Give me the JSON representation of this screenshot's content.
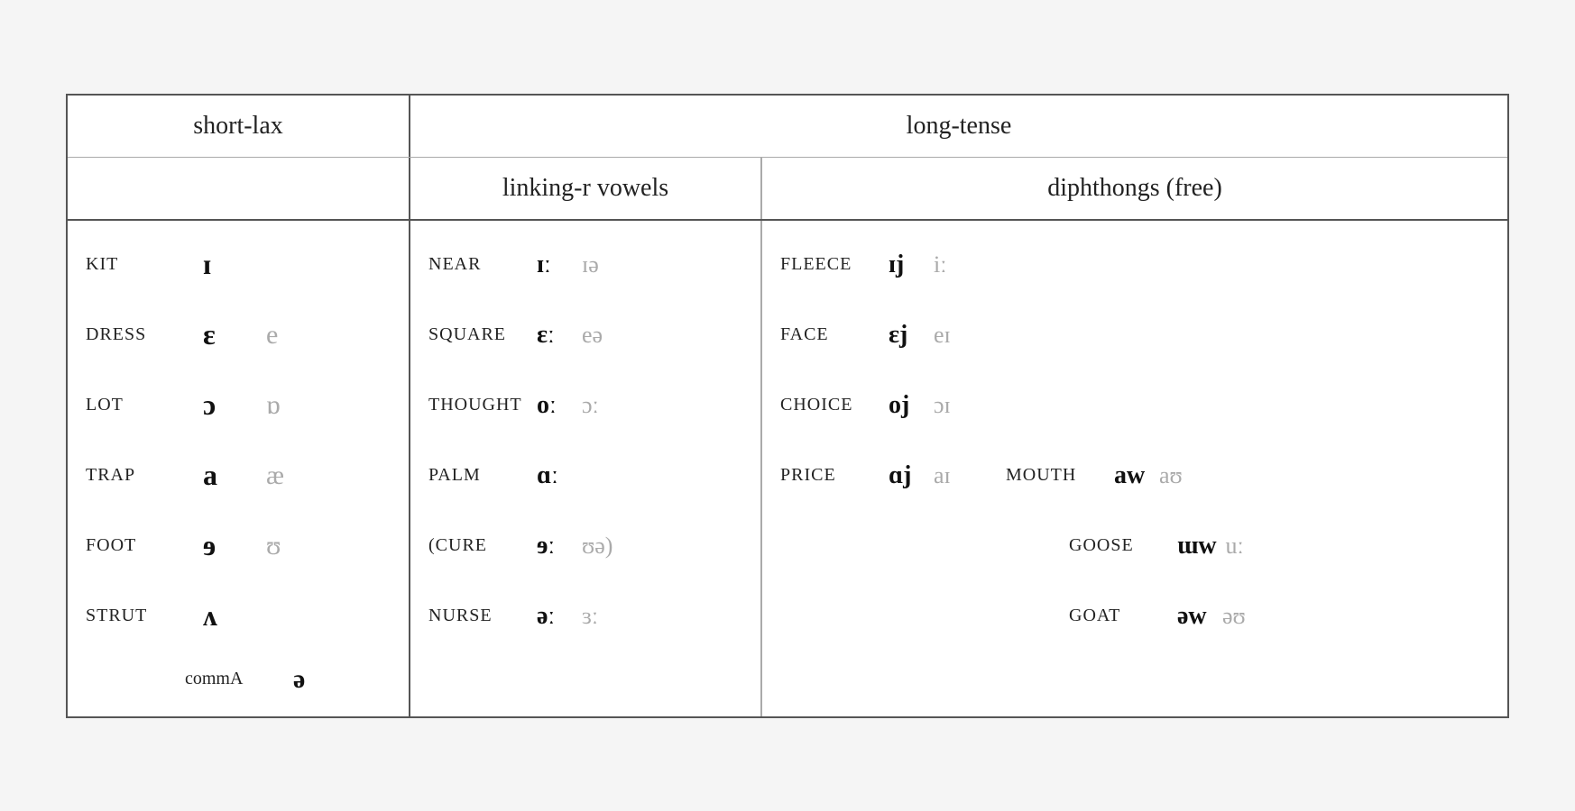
{
  "headers": {
    "short_lax": "short-lax",
    "long_tense": "long-tense",
    "linking_r": "linking-r vowels",
    "diphthongs": "diphthongs (free)"
  },
  "short_lax_rows": [
    {
      "word": "KIT",
      "primary": "ɪ",
      "secondary": ""
    },
    {
      "word": "DRESS",
      "primary": "ɛ",
      "secondary": "e"
    },
    {
      "word": "LOT",
      "primary": "ɔ",
      "secondary": "ɒ"
    },
    {
      "word": "TRAP",
      "primary": "a",
      "secondary": "æ"
    },
    {
      "word": "FOOT",
      "primary": "ɘ",
      "secondary": "ʊ"
    },
    {
      "word": "STRUT",
      "primary": "ʌ",
      "secondary": ""
    }
  ],
  "short_lax_comma": {
    "label": "commA",
    "symbol": "ə"
  },
  "linking_r_rows": [
    {
      "word": "NEAR",
      "primary": "ɪː",
      "secondary": "ɪə"
    },
    {
      "word": "SQUARE",
      "primary": "ɛː",
      "secondary": "eə"
    },
    {
      "word": "THOUGHT",
      "primary": "oː",
      "secondary": "ɔː"
    },
    {
      "word": "PALM",
      "primary": "ɑː",
      "secondary": ""
    },
    {
      "word": "(CURE",
      "primary": "ɘː",
      "secondary": "ʊə)"
    },
    {
      "word": "NURSE",
      "primary": "əː",
      "secondary": "ɜː"
    }
  ],
  "diphthong_rows": [
    {
      "left": {
        "word": "FLEECE",
        "primary": "ɪj",
        "secondary": "iː"
      },
      "right": null
    },
    {
      "left": {
        "word": "FACE",
        "primary": "ɛj",
        "secondary": "eɪ"
      },
      "right": null
    },
    {
      "left": {
        "word": "CHOICE",
        "primary": "oj",
        "secondary": "ɔɪ"
      },
      "right": null
    },
    {
      "left": {
        "word": "PRICE",
        "primary": "ɑj",
        "secondary": "aɪ"
      },
      "right": {
        "word": "MOUTH",
        "primary": "aw",
        "secondary": "aʊ"
      }
    },
    {
      "left": null,
      "right": {
        "word": "GOOSE",
        "primary": "ɯw",
        "secondary": "uː"
      }
    },
    {
      "left": null,
      "right": {
        "word": "GOAT",
        "primary": "əw",
        "secondary": "əʊ"
      }
    }
  ]
}
